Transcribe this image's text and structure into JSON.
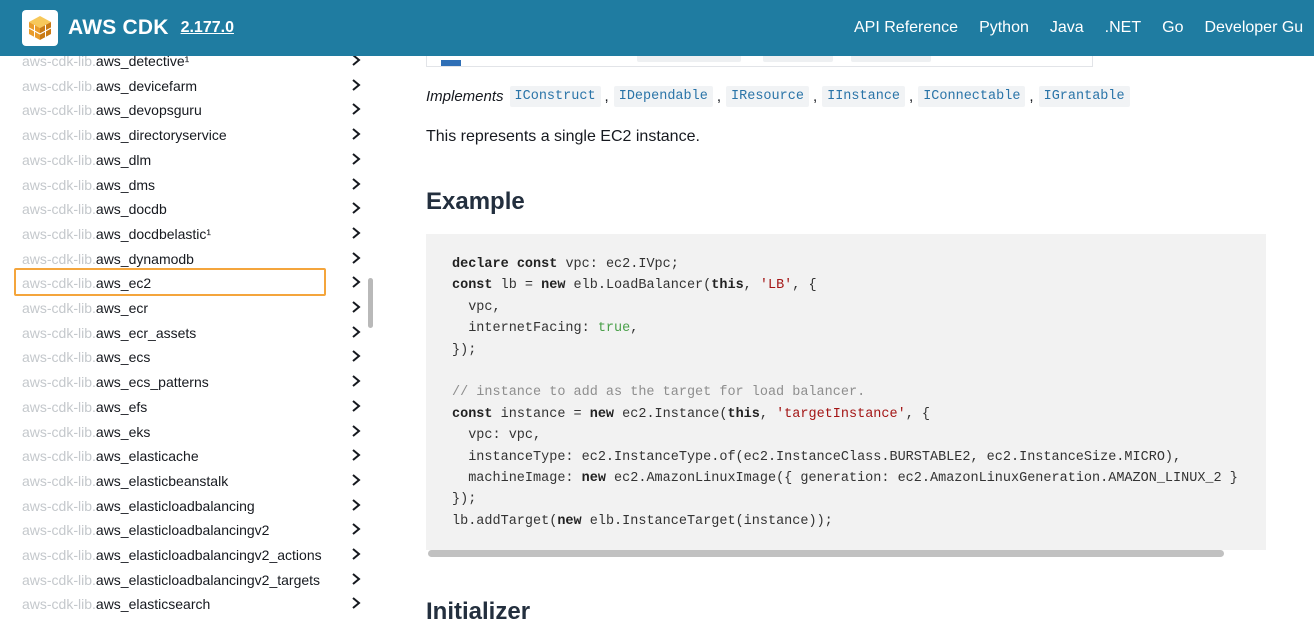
{
  "header": {
    "logo_icon": "aws-cdk-cube-icon",
    "title": "AWS CDK",
    "version": "2.177.0",
    "nav": [
      "API Reference",
      "Python",
      "Java",
      ".NET",
      "Go",
      "Developer Gu"
    ],
    "background_color": "#1f7ca1"
  },
  "sidebar": {
    "prefix": "aws-cdk-lib.",
    "selected_index": 9,
    "selected_border_color": "#f4a53c",
    "items": [
      {
        "name": "aws_detective¹"
      },
      {
        "name": "aws_devicefarm"
      },
      {
        "name": "aws_devopsguru"
      },
      {
        "name": "aws_directoryservice"
      },
      {
        "name": "aws_dlm"
      },
      {
        "name": "aws_dms"
      },
      {
        "name": "aws_docdb"
      },
      {
        "name": "aws_docdbelastic¹"
      },
      {
        "name": "aws_dynamodb"
      },
      {
        "name": "aws_ec2"
      },
      {
        "name": "aws_ecr"
      },
      {
        "name": "aws_ecr_assets"
      },
      {
        "name": "aws_ecs"
      },
      {
        "name": "aws_ecs_patterns"
      },
      {
        "name": "aws_efs"
      },
      {
        "name": "aws_eks"
      },
      {
        "name": "aws_elasticache"
      },
      {
        "name": "aws_elasticbeanstalk"
      },
      {
        "name": "aws_elasticloadbalancing"
      },
      {
        "name": "aws_elasticloadbalancingv2"
      },
      {
        "name": "aws_elasticloadbalancingv2_actions"
      },
      {
        "name": "aws_elasticloadbalancingv2_targets"
      },
      {
        "name": "aws_elasticsearch"
      }
    ]
  },
  "main": {
    "implements_label": "Implements",
    "interfaces": [
      "IConstruct",
      "IDependable",
      "IResource",
      "IInstance",
      "IConnectable",
      "IGrantable"
    ],
    "description": "This represents a single EC2 instance.",
    "example_heading": "Example",
    "code": [
      [
        [
          "k",
          "declare"
        ],
        [
          "p",
          " "
        ],
        [
          "k",
          "const"
        ],
        [
          "p",
          " vpc: ec2.IVpc;"
        ]
      ],
      [
        [
          "k",
          "const"
        ],
        [
          "p",
          " lb = "
        ],
        [
          "k",
          "new"
        ],
        [
          "p",
          " elb.LoadBalancer("
        ],
        [
          "k",
          "this"
        ],
        [
          "p",
          ", "
        ],
        [
          "s",
          "'LB'"
        ],
        [
          "p",
          ", {"
        ]
      ],
      [
        [
          "p",
          "  vpc,"
        ]
      ],
      [
        [
          "p",
          "  internetFacing: "
        ],
        [
          "t",
          "true"
        ],
        [
          "p",
          ","
        ]
      ],
      [
        [
          "p",
          "});"
        ]
      ],
      [
        [
          "p",
          ""
        ]
      ],
      [
        [
          "c",
          "// instance to add as the target for load balancer."
        ]
      ],
      [
        [
          "k",
          "const"
        ],
        [
          "p",
          " instance = "
        ],
        [
          "k",
          "new"
        ],
        [
          "p",
          " ec2.Instance("
        ],
        [
          "k",
          "this"
        ],
        [
          "p",
          ", "
        ],
        [
          "s",
          "'targetInstance'"
        ],
        [
          "p",
          ", {"
        ]
      ],
      [
        [
          "p",
          "  vpc: vpc,"
        ]
      ],
      [
        [
          "p",
          "  instanceType: ec2.InstanceType.of(ec2.InstanceClass.BURSTABLE2, ec2.InstanceSize.MICRO),"
        ]
      ],
      [
        [
          "p",
          "  machineImage: "
        ],
        [
          "k",
          "new"
        ],
        [
          "p",
          " ec2.AmazonLinuxImage({ generation: ec2.AmazonLinuxGeneration.AMAZON_LINUX_2 }"
        ]
      ],
      [
        [
          "p",
          "});"
        ]
      ],
      [
        [
          "p",
          "lb.addTarget("
        ],
        [
          "k",
          "new"
        ],
        [
          "p",
          " elb.InstanceTarget(instance));"
        ]
      ]
    ],
    "initializer_heading": "Initializer"
  }
}
